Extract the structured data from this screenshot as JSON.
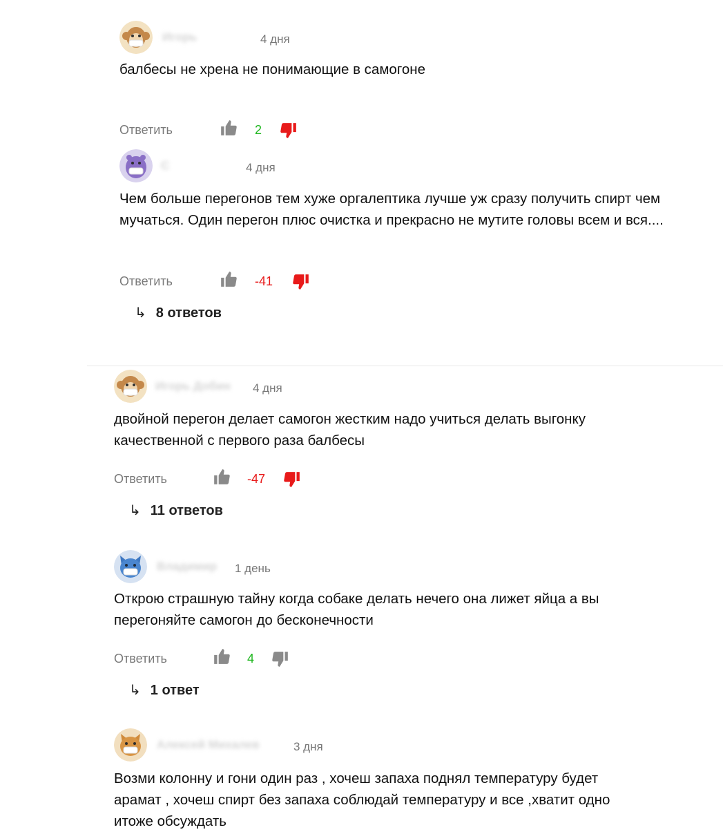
{
  "reply_label": "Ответить",
  "colors": {
    "like_count_positive": "#1fb71f",
    "like_count_negative": "#e81a1a",
    "dislike_active": "#e81a1a",
    "icon_inactive": "#8a8a8a"
  },
  "comments": [
    {
      "author": "Игорь",
      "time": "4 дня",
      "text": "балбесы не хрена не понимающие в самогоне",
      "likes": "2",
      "avatar_icon": "monkey-avatar-icon"
    },
    {
      "author": "С",
      "time": "4 дня",
      "text": "Чем больше перегонов тем хуже оргалептика лучше уж сразу получить спирт чем мучаться. Один перегон плюс очистка и прекрасно не мутите головы всем и вся....",
      "likes": "-41",
      "replies": "8 ответов",
      "avatar_icon": "hippo-avatar-icon"
    },
    {
      "author": "Игорь Добин",
      "time": "4 дня",
      "text": "двойной перегон делает самогон жестким надо учиться делать выгонку качественной с первого раза балбесы",
      "likes": "-47",
      "replies": "11 ответов",
      "avatar_icon": "monkey-avatar-icon"
    },
    {
      "author": "Владимир",
      "time": "1 день",
      "text": "Открою страшную тайну когда собаке делать нечего она лижет яйца а вы перегоняйте самогон до бесконечности",
      "likes": "4",
      "replies": "1 ответ",
      "avatar_icon": "fox-avatar-icon"
    },
    {
      "author": "Алексей Михалев",
      "time": "3 дня",
      "text": "Возми колонну и гони один раз , хочеш запаха поднял температуру будет арамат , хочеш спирт без запаха соблюдай температуру и все ,хватит одно итоже обсуждать",
      "avatar_icon": "cat-avatar-icon"
    }
  ]
}
